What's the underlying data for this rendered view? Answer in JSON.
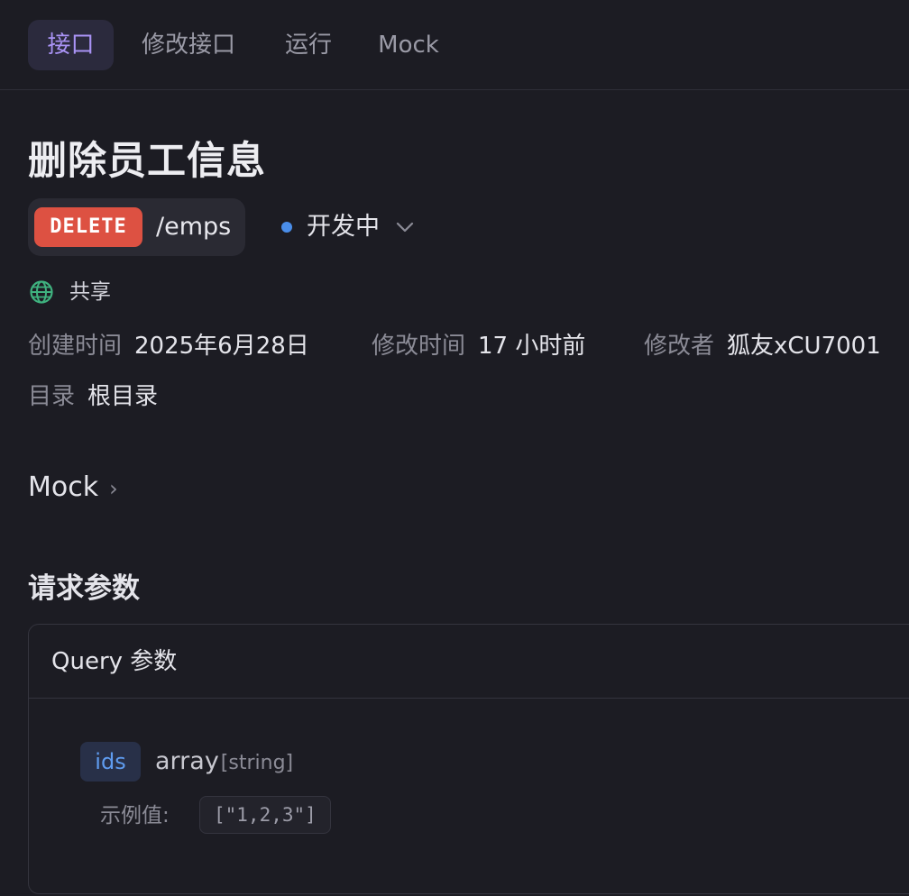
{
  "tabs": [
    {
      "label": "接口",
      "active": true
    },
    {
      "label": "修改接口",
      "active": false
    },
    {
      "label": "运行",
      "active": false
    },
    {
      "label": "Mock",
      "active": false
    }
  ],
  "endpoint": {
    "title": "删除员工信息",
    "method": "DELETE",
    "method_color": "#dd5142",
    "path": "/emps",
    "status": "开发中",
    "status_color": "#4a8eea",
    "visibility": "共享",
    "visibility_icon": "globe-icon"
  },
  "meta": {
    "created_label": "创建时间",
    "created_value": "2025年6月28日",
    "modified_label": "修改时间",
    "modified_value": "17 小时前",
    "modifier_label": "修改者",
    "modifier_value": "狐友xCU7001",
    "folder_label": "目录",
    "folder_value": "根目录"
  },
  "mock_section": {
    "label": "Mock",
    "chevron": "›"
  },
  "request_params": {
    "title": "请求参数",
    "query_header": "Query 参数",
    "params": [
      {
        "name": "ids",
        "type": "array",
        "subtype": "[string]",
        "example_label": "示例值:",
        "example_value": "[\"1,2,3\"]"
      }
    ]
  }
}
